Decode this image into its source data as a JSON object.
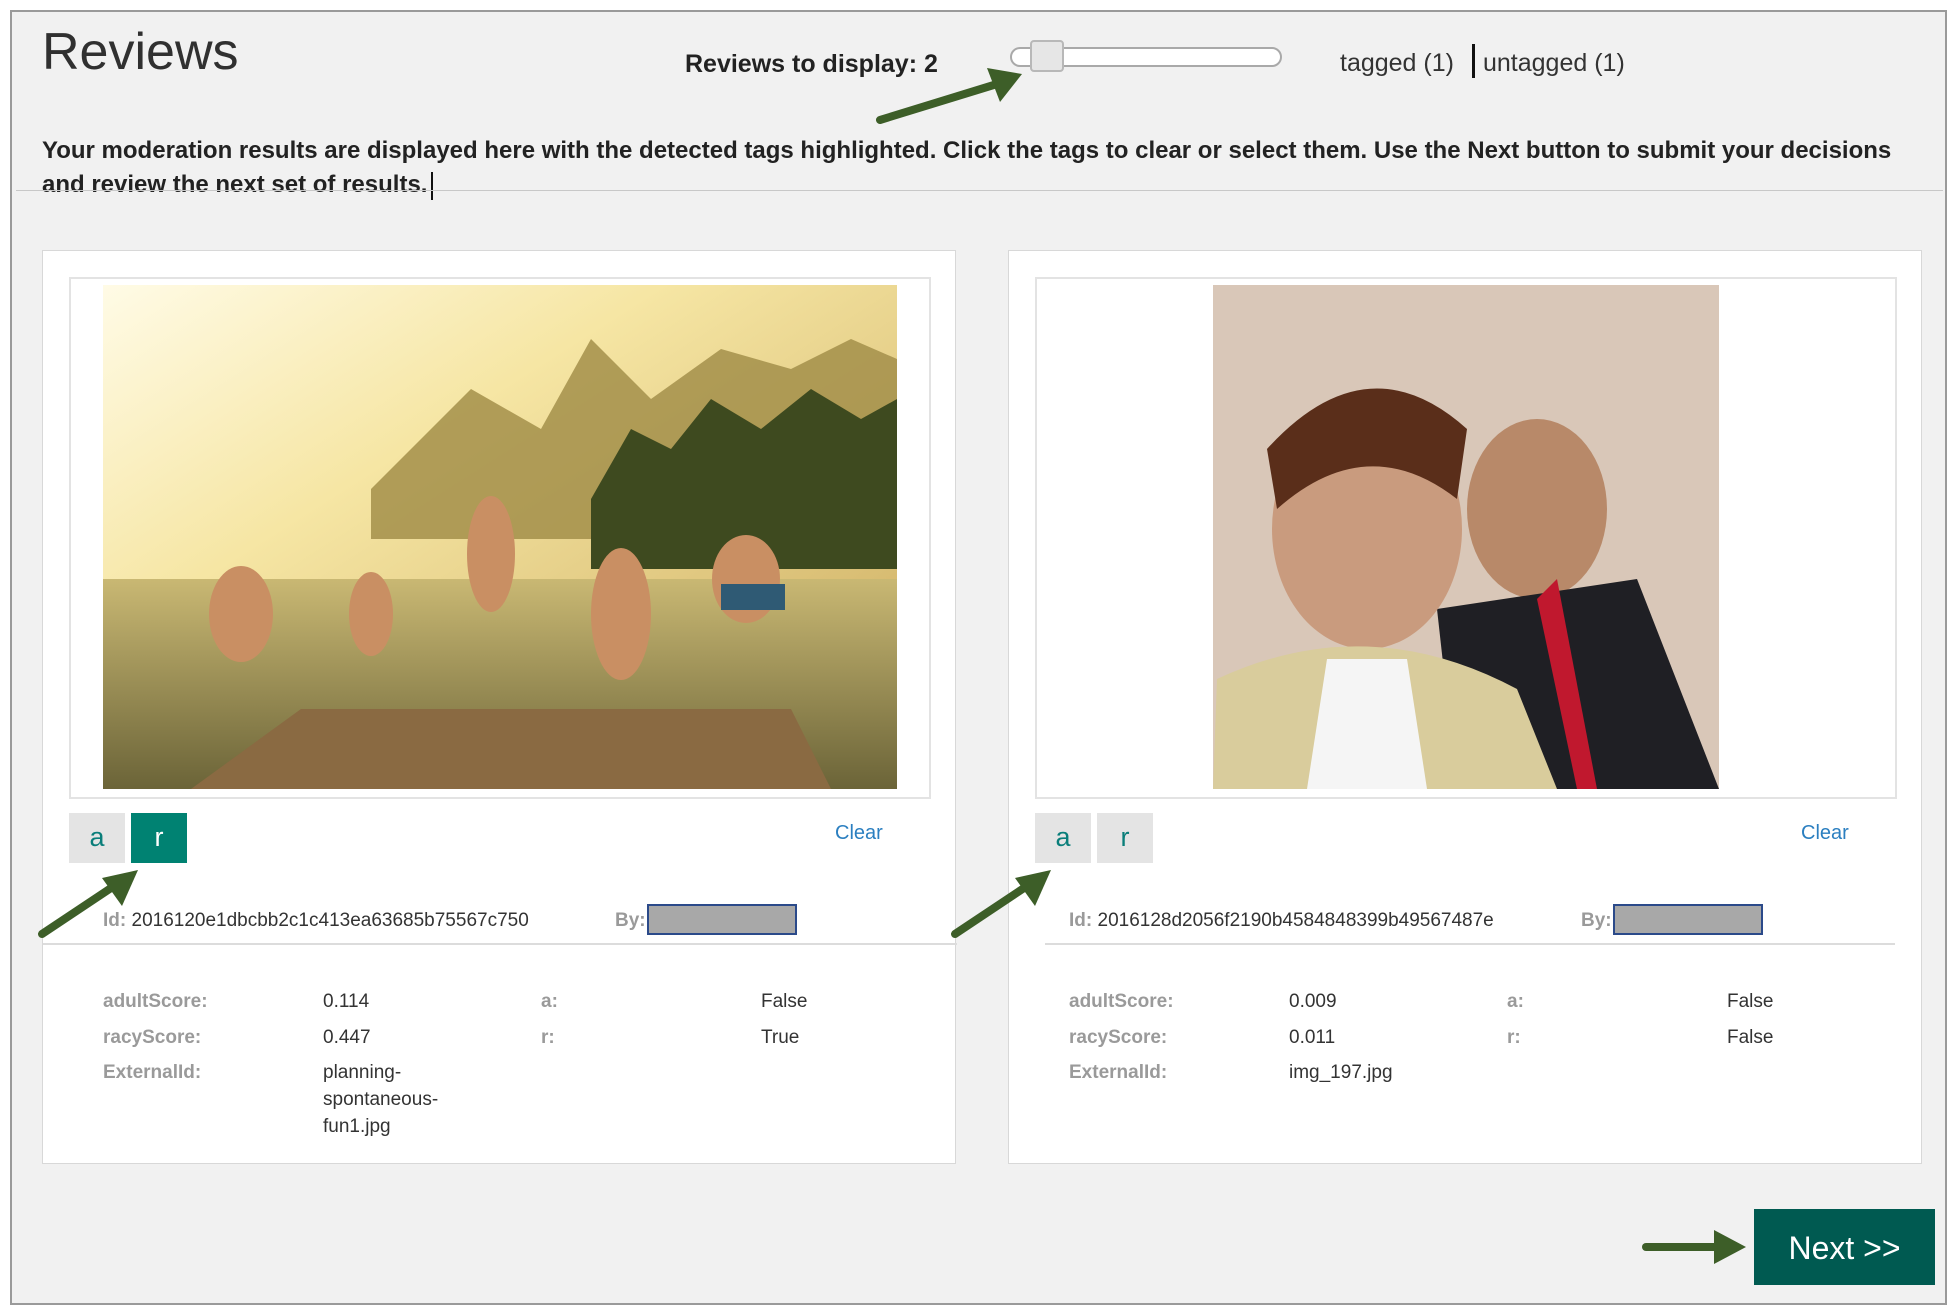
{
  "header": {
    "title": "Reviews",
    "reviews_to_display_label": "Reviews to display: 2",
    "slider_value": 2,
    "filter_tagged": "tagged (1)",
    "filter_untagged": "untagged (1)",
    "instructions": "Your moderation results are displayed here with the detected tags highlighted. Click the tags to clear or select them. Use the Next button to submit your decisions and review the next set of results."
  },
  "reviews": [
    {
      "tags": [
        {
          "label": "a",
          "selected": false
        },
        {
          "label": "r",
          "selected": true
        }
      ],
      "clear_label": "Clear",
      "id_label": "Id:",
      "id_value": "2016120e1dbcbb2c1c413ea63685b75567c750",
      "by_label": "By:",
      "metadata": {
        "adult_score_label": "adultScore:",
        "adult_score": "0.114",
        "racy_score_label": "racyScore:",
        "racy_score": "0.447",
        "external_id_label": "ExternalId:",
        "external_id": "planning-spontaneous-fun1.jpg",
        "a_label": "a:",
        "a_value": "False",
        "r_label": "r:",
        "r_value": "True"
      }
    },
    {
      "tags": [
        {
          "label": "a",
          "selected": false
        },
        {
          "label": "r",
          "selected": false
        }
      ],
      "clear_label": "Clear",
      "id_label": "Id:",
      "id_value": "2016128d2056f2190b4584848399b49567487e",
      "by_label": "By:",
      "metadata": {
        "adult_score_label": "adultScore:",
        "adult_score": "0.009",
        "racy_score_label": "racyScore:",
        "racy_score": "0.011",
        "external_id_label": "ExternalId:",
        "external_id": "img_197.jpg",
        "a_label": "a:",
        "a_value": "False",
        "r_label": "r:",
        "r_value": "False"
      }
    }
  ],
  "footer": {
    "next_label": "Next >>"
  },
  "colors": {
    "accent_teal": "#008272",
    "next_button": "#005a51",
    "annotation_arrow": "#3d5e28",
    "link": "#2b7fc0"
  }
}
